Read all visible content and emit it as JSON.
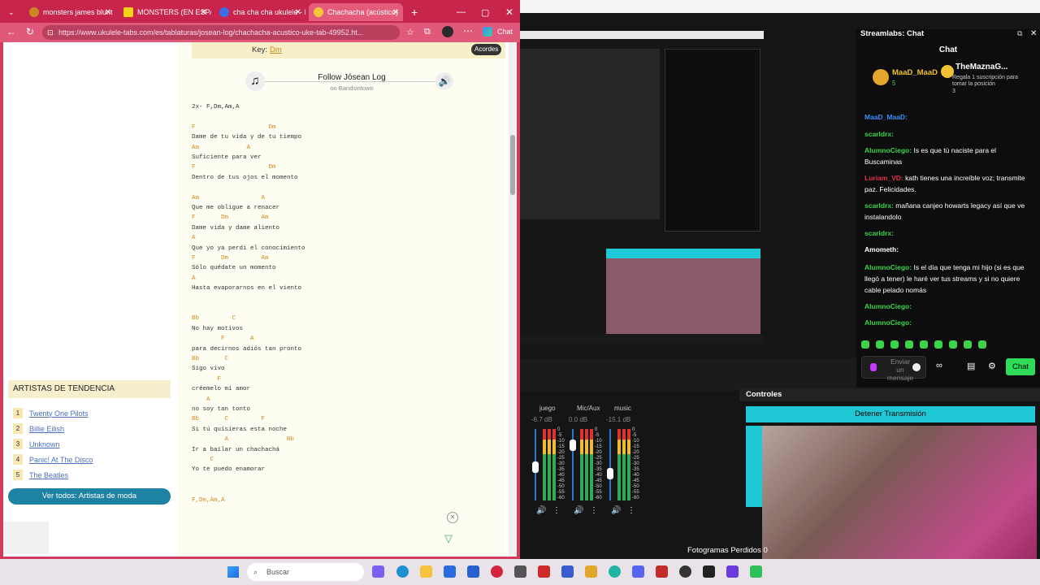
{
  "browser": {
    "tabs": [
      {
        "label": "monsters james blunt"
      },
      {
        "label": "MONSTERS (EN ESPAÑOL)"
      },
      {
        "label": "cha cha cha ukulele - Bús"
      },
      {
        "label": "Chachacha (acústico)"
      }
    ],
    "url": "https://www.ukulele-tabs.com/es/tablaturas/josean-log/chachacha-acustico-uke-tab-49952.ht...",
    "chat_button": "Chat"
  },
  "song": {
    "key_label": "Key:",
    "key_value": "Dm",
    "acordes": "Acordes",
    "follow": "Follow Jósean Log",
    "bandsintown": "on Bandsintown",
    "lines": [
      {
        "c": "2x- F,Dm,Am,A",
        "t": "lyr"
      },
      {
        "c": "",
        "t": "gap"
      },
      {
        "c": "F                    Dm",
        "t": "chord"
      },
      {
        "c": "Dame de tu vida y de tu tiempo",
        "t": "lyr"
      },
      {
        "c": "Am             A",
        "t": "chord"
      },
      {
        "c": "Suficiente para ver",
        "t": "lyr"
      },
      {
        "c": "F                    Dm",
        "t": "chord"
      },
      {
        "c": "Dentro de tus ojos el momento",
        "t": "lyr"
      },
      {
        "c": "",
        "t": "gap"
      },
      {
        "c": "Am                 A",
        "t": "chord"
      },
      {
        "c": "Que me obligue a renacer",
        "t": "lyr"
      },
      {
        "c": "F       Dm         Am",
        "t": "chord"
      },
      {
        "c": "Dame vida y dame aliento",
        "t": "lyr"
      },
      {
        "c": "A",
        "t": "chord"
      },
      {
        "c": "Que yo ya perdí el conocimiento",
        "t": "lyr"
      },
      {
        "c": "F       Dm         Am",
        "t": "chord"
      },
      {
        "c": "Sólo quédate un momento",
        "t": "lyr"
      },
      {
        "c": "A",
        "t": "chord"
      },
      {
        "c": "Hasta evaporarnos en el viento",
        "t": "lyr"
      },
      {
        "c": "",
        "t": "gap"
      },
      {
        "c": "",
        "t": "gap"
      },
      {
        "c": "Bb         C",
        "t": "chord"
      },
      {
        "c": "No hay motivos",
        "t": "lyr"
      },
      {
        "c": "        F       A",
        "t": "chord"
      },
      {
        "c": "para decirnos adiós tan pronto",
        "t": "lyr"
      },
      {
        "c": "Bb       C",
        "t": "chord"
      },
      {
        "c": "Sigo vivo",
        "t": "lyr"
      },
      {
        "c": "       F",
        "t": "chord"
      },
      {
        "c": "créemelo mi amor",
        "t": "lyr"
      },
      {
        "c": "    A",
        "t": "chord"
      },
      {
        "c": "no soy tan tonto",
        "t": "lyr"
      },
      {
        "c": "Bb       C         F",
        "t": "chord"
      },
      {
        "c": "Si tú quisieras esta noche",
        "t": "lyr"
      },
      {
        "c": "         A                Bb",
        "t": "chord"
      },
      {
        "c": "Ir a bailar un chachachá",
        "t": "lyr"
      },
      {
        "c": "     C",
        "t": "chord"
      },
      {
        "c": "Yo te puedo enamorar",
        "t": "lyr"
      },
      {
        "c": "",
        "t": "gap"
      },
      {
        "c": "",
        "t": "gap"
      },
      {
        "c": "F,Dm,Am,A",
        "t": "chord"
      }
    ]
  },
  "trending": {
    "title": "ARTISTAS DE TENDENCIA",
    "items": [
      {
        "n": "1",
        "name": "Twenty One Pilots"
      },
      {
        "n": "2",
        "name": "Billie Eilish"
      },
      {
        "n": "3",
        "name": "Unknown"
      },
      {
        "n": "4",
        "name": "Panic! At The Disco"
      },
      {
        "n": "5",
        "name": "The Beatles"
      }
    ],
    "view_all": "Ver todos: Artistas de moda"
  },
  "streamlabs": {
    "chat_title": "Streamlabs: Chat",
    "chat_header": "Chat",
    "pinned_user": "MaaD_MaaD",
    "pinned_count": "5",
    "sub_user": "TheMaznaG...",
    "sub_text": "Regala 1 suscripción para tomar la posición",
    "sub_num": "3",
    "messages": [
      {
        "user": "MaaD_MaaD:",
        "text": "",
        "color": "#3c8cff"
      },
      {
        "user": "scarldrx:",
        "text": "",
        "color": "#3ad34a"
      },
      {
        "user": "AlumnoCiego:",
        "text": "Is es que tú naciste para el Buscaminas",
        "color": "#3ad34a"
      },
      {
        "user": "Luriam_VD:",
        "text": "kath tienes una increíble voz; transmite paz. Felicidades.",
        "color": "#e0334a"
      },
      {
        "user": "scarldrx:",
        "text": "mañana canjeo howarts legacy así que ve instalandolo",
        "color": "#3ad34a"
      },
      {
        "user": "scarldrx:",
        "text": "",
        "color": "#3ad34a"
      },
      {
        "user": "Amometh:",
        "text": "",
        "color": "#fff"
      },
      {
        "user": "AlumnoCiego:",
        "text": "Is el día que tenga mi hijo (si es que llegó a tener) le haré ver tus streams y si no quiere cable pelado nomás",
        "color": "#3ad34a"
      },
      {
        "user": "AlumnoCiego:",
        "text": "",
        "color": "#3ad34a"
      },
      {
        "user": "AlumnoCiego:",
        "text": "",
        "color": "#3ad34a"
      }
    ],
    "send_placeholder": "Enviar un mensaje",
    "chat_button": "Chat",
    "controls": "Controles",
    "stop_stream": "Detener Transmisión",
    "lost_frames": "Fotogramas Perdidos 0",
    "mixer": [
      {
        "name": "juego",
        "db": "-6.7 dB",
        "level": 0.55
      },
      {
        "name": "Mic/Aux",
        "db": "0.0 dB",
        "level": 0.85
      },
      {
        "name": "music",
        "db": "-15.1 dB",
        "level": 0.45
      }
    ],
    "scale": [
      "0",
      "-5",
      "-10",
      "-15",
      "-20",
      "-25",
      "-30",
      "-35",
      "-40",
      "-45",
      "-50",
      "-55",
      "-60"
    ]
  },
  "taskbar": {
    "search": "Buscar"
  }
}
